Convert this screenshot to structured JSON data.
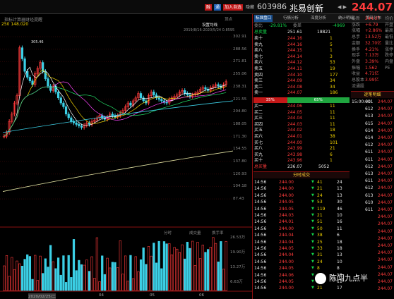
{
  "header": {
    "code": "603986",
    "name": "兆易创新",
    "price": "244.07",
    "btn_rong": "融",
    "btn_tong": "通",
    "btn_add": "加入自选",
    "btn_menu": "隐藏"
  },
  "chart": {
    "label_top": "250 148.020",
    "tabs": [
      "指标计算器",
      "财经提醒"
    ],
    "settings": [
      "设置均线"
    ],
    "date_label": "2019/8/16-2020/5/24 0.8595",
    "ma_right": "2020/5/24 0.85",
    "high_label": "305.46",
    "y_prices": [
      "302.91",
      "288.56",
      "271.81",
      "255.06",
      "238.31",
      "221.55",
      "204.80",
      "188.05",
      "171.30",
      "154.55",
      "137.80",
      "120.93",
      "104.18",
      "87.43"
    ],
    "vol_tabs": [
      "分时",
      "成交量",
      "换手率"
    ],
    "vol_y": [
      "26.53万",
      "19.90万",
      "13.27万",
      "6.63万"
    ],
    "x_labels": [
      "2020/02/25/二",
      "04",
      "05",
      "06"
    ],
    "side": "顶点"
  },
  "panel": {
    "tabs": [
      "标准盘口",
      "行情分析",
      "深度分析",
      "统计明细",
      "筹码分布"
    ],
    "top": {
      "wb_label": "委比",
      "wb": "-29.81%",
      "wc_label": "委差",
      "wc": "-4969",
      "zd_label": "总卖量",
      "zd": "251.61",
      "zd2": "18821"
    },
    "asks": [
      {
        "lv": "卖十",
        "p": "244.16",
        "v": "1"
      },
      {
        "lv": "卖九",
        "p": "244.16",
        "v": "5"
      },
      {
        "lv": "卖八",
        "p": "244.15",
        "v": "1"
      },
      {
        "lv": "卖七",
        "p": "244.14",
        "v": "3"
      },
      {
        "lv": "卖六",
        "p": "244.12",
        "v": "53"
      },
      {
        "lv": "卖五",
        "p": "244.11",
        "v": "19"
      },
      {
        "lv": "卖四",
        "p": "244.10",
        "v": "177"
      },
      {
        "lv": "卖三",
        "p": "244.09",
        "v": "34"
      },
      {
        "lv": "卖二",
        "p": "244.08",
        "v": "34"
      },
      {
        "lv": "卖一",
        "p": "244.07",
        "v": "186"
      }
    ],
    "ratio": {
      "left": "35%",
      "right": "65%"
    },
    "bids": [
      {
        "lv": "买一",
        "p": "244.06",
        "v": "11"
      },
      {
        "lv": "买二",
        "p": "244.05",
        "v": "11"
      },
      {
        "lv": "买三",
        "p": "244.04",
        "v": "11"
      },
      {
        "lv": "买四",
        "p": "244.03",
        "v": "11"
      },
      {
        "lv": "买五",
        "p": "244.02",
        "v": "18"
      },
      {
        "lv": "买六",
        "p": "244.01",
        "v": "38"
      },
      {
        "lv": "买七",
        "p": "244.00",
        "v": "101"
      },
      {
        "lv": "买八",
        "p": "243.99",
        "v": "21"
      },
      {
        "lv": "买九",
        "p": "243.98",
        "v": "6"
      },
      {
        "lv": "买十",
        "p": "243.96",
        "v": "1"
      }
    ],
    "bottom": {
      "label": "总买量",
      "a": "236.07",
      "b": "5052"
    },
    "trades_title": "分时成交",
    "trades": [
      {
        "t": "14:56",
        "p": "244.00",
        "v": "41",
        "n": "24"
      },
      {
        "t": "14:56",
        "p": "244.00",
        "v": "21",
        "n": "13"
      },
      {
        "t": "14:56",
        "p": "244.00",
        "v": "24",
        "n": "13"
      },
      {
        "t": "14:56",
        "p": "244.05",
        "v": "53",
        "n": "30"
      },
      {
        "t": "14:56",
        "p": "244.05",
        "v": "119",
        "n": "46"
      },
      {
        "t": "14:56",
        "p": "244.03",
        "v": "21",
        "n": "10"
      },
      {
        "t": "14:56",
        "p": "244.01",
        "v": "51",
        "n": "16"
      },
      {
        "t": "14:56",
        "p": "244.00",
        "v": "50",
        "n": "11"
      },
      {
        "t": "14:56",
        "p": "244.04",
        "v": "38",
        "n": "6"
      },
      {
        "t": "14:56",
        "p": "244.04",
        "v": "25",
        "n": "18"
      },
      {
        "t": "14:56",
        "p": "244.05",
        "v": "33",
        "n": "18"
      },
      {
        "t": "14:56",
        "p": "244.04",
        "v": "31",
        "n": "13"
      },
      {
        "t": "14:56",
        "p": "244.00",
        "v": "24",
        "n": "10"
      },
      {
        "t": "14:56",
        "p": "244.05",
        "v": "8",
        "n": "8"
      },
      {
        "t": "14:56",
        "p": "244.06",
        "v": "8",
        "n": "18"
      },
      {
        "t": "14:56",
        "p": "244.05",
        "v": "11",
        "n": "11"
      },
      {
        "t": "14:56",
        "p": "244.00",
        "v": "21",
        "n": "17"
      }
    ],
    "info": [
      {
        "k": "最新",
        "v": "244.07",
        "k2": "均价"
      },
      {
        "k": "涨跌",
        "v": "+6.79",
        "k2": "开盘"
      },
      {
        "k": "涨幅",
        "v": "+2.86%",
        "k2": "最高"
      },
      {
        "k": "总手",
        "v": "13.52万",
        "k2": "最低"
      },
      {
        "k": "金额",
        "v": "32.70亿",
        "k2": "量比"
      },
      {
        "k": "换手",
        "v": "4.21%",
        "k2": "涨停"
      },
      {
        "k": "现手",
        "v": "7.13万",
        "k2": "跌停"
      },
      {
        "k": "外盘",
        "v": "3.39%",
        "k2": "内盘"
      },
      {
        "k": "振幅",
        "v": "1.562",
        "k2": "PE"
      },
      {
        "k": "收益",
        "v": "4.71亿",
        "k2": ""
      },
      {
        "k": "总股本",
        "v": "3.99亿",
        "k2": ""
      },
      {
        "k": "流通股",
        "v": "",
        "k2": ""
      }
    ],
    "flow_title": "逐笔明细",
    "flow": [
      {
        "t": "15:00:00",
        "p": "244.07"
      },
      {
        "t": "",
        "p": "244.07"
      },
      {
        "t": "",
        "p": "244.07"
      },
      {
        "t": "",
        "p": "244.07"
      },
      {
        "t": "",
        "p": "244.07"
      },
      {
        "t": "",
        "p": "244.07"
      },
      {
        "t": "",
        "p": "244.07"
      },
      {
        "t": "",
        "p": "244.07"
      },
      {
        "t": "",
        "p": "244.07"
      },
      {
        "t": "",
        "p": "244.07"
      },
      {
        "t": "",
        "p": "244.07"
      },
      {
        "t": "",
        "p": "244.07"
      },
      {
        "t": "",
        "p": "244.07"
      },
      {
        "t": "",
        "p": "244.07"
      },
      {
        "t": "",
        "p": "244.07"
      },
      {
        "t": "",
        "p": "244.07"
      },
      {
        "t": "",
        "p": "244.07"
      },
      {
        "t": "",
        "p": "244.07"
      },
      {
        "t": "",
        "p": "244.07"
      },
      {
        "t": "",
        "p": "244.07"
      },
      {
        "t": "",
        "p": "244.07"
      },
      {
        "t": "",
        "p": "244.07"
      },
      {
        "t": "",
        "p": "244.07"
      },
      {
        "t": "",
        "p": "244.07"
      },
      {
        "t": "",
        "p": "244.07"
      },
      {
        "t": "",
        "p": "244.07"
      },
      {
        "t": "",
        "p": "244.07"
      }
    ],
    "flow_side": [
      "611",
      "612",
      "613",
      "615",
      "614",
      "614",
      "612",
      "611",
      "611",
      "612",
      "613",
      "611",
      "612",
      "613",
      "610",
      "611"
    ]
  },
  "watermark": "陈闯九点半",
  "colors": {
    "up": "#ff3b3b",
    "down": "#3cd0e6",
    "ma5": "#ffffff",
    "ma10": "#f0d000",
    "ma20": "#ff44ff",
    "ma60": "#22dd66"
  }
}
